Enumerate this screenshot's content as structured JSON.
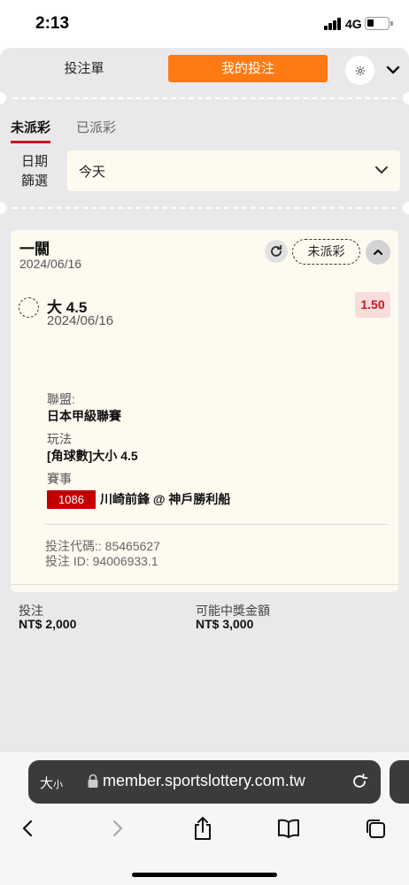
{
  "status_bar": {
    "time": "2:13",
    "network": "4G",
    "battery_level": 0.3
  },
  "header": {
    "tab_bet_slip": "投注單",
    "tab_my_bets": "我的投注",
    "active_tab": "我的投注",
    "accent_color": "#ff7a12",
    "settings_icon": "gear-icon",
    "dropdown_icon": "chevron-down-icon"
  },
  "status_tabs": {
    "unsettled": "未派彩",
    "settled": "已派彩",
    "active": "未派彩",
    "underline_color": "#c8161d"
  },
  "date_filter": {
    "label": "日期篩選",
    "value": "今天"
  },
  "bet": {
    "type": "一關",
    "date": "2024/06/16",
    "status": "未派彩",
    "selection": {
      "name": "大 4.5",
      "date": "2024/06/16",
      "odds": "1.50"
    },
    "league_label": "聯盟:",
    "league": "日本甲級聯賽",
    "market_label": "玩法",
    "market": "[角球數]大小 4.5",
    "event_label": "賽事",
    "event_id": "1086",
    "event_name": "川崎前鋒 @ 神戶勝利船",
    "bet_code": "投注代碼:: 85465627",
    "bet_id": "投注 ID: 94006933.1",
    "stake_label": "投注",
    "stake": "NT$ 2,000",
    "potential_win_label": "可能中獎金額",
    "potential_win": "NT$ 3,000"
  },
  "browser": {
    "text_size": "大小",
    "url": "member.sportslottery.com.tw"
  }
}
